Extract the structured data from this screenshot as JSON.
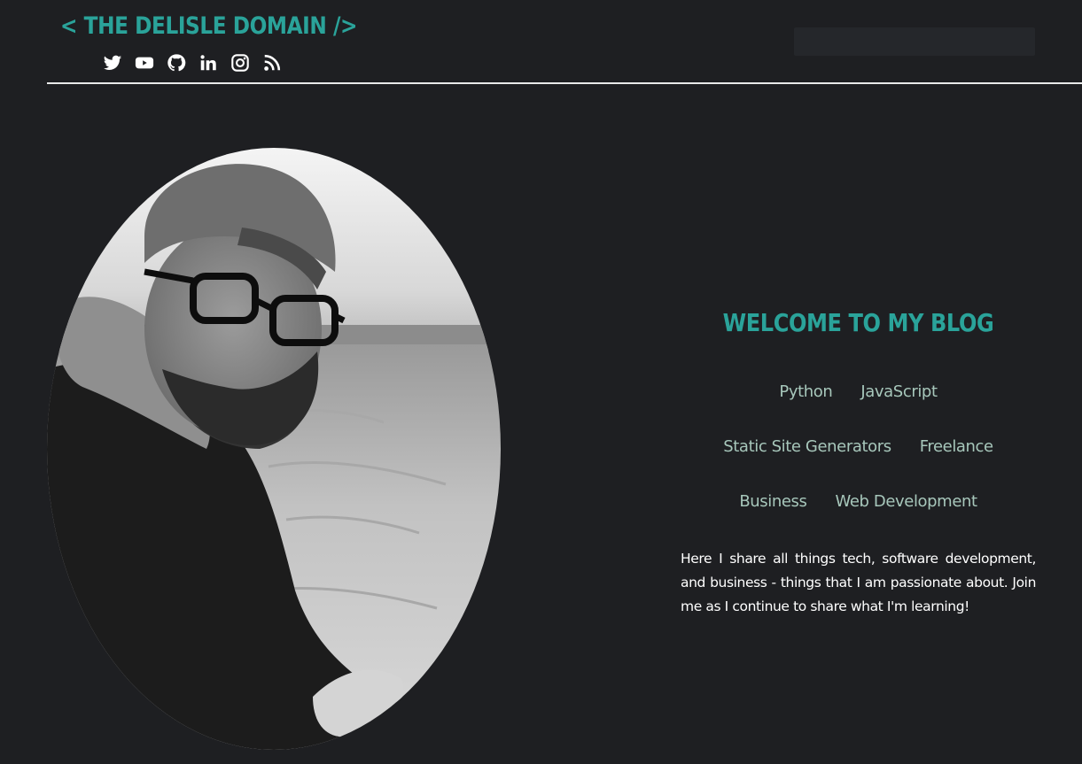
{
  "header": {
    "logo_text": "< THE DELISLE DOMAIN />",
    "social_links": [
      {
        "name": "twitter-icon"
      },
      {
        "name": "youtube-icon"
      },
      {
        "name": "github-icon"
      },
      {
        "name": "linkedin-icon"
      },
      {
        "name": "instagram-icon"
      },
      {
        "name": "rss-icon"
      }
    ],
    "search_placeholder": ""
  },
  "hero": {
    "portrait_alt": "Profile photo on a beach"
  },
  "intro": {
    "title": "WELCOME TO MY BLOG",
    "tag_rows": [
      [
        "Python",
        "JavaScript"
      ],
      [
        "Static Site Generators",
        "Freelance"
      ],
      [
        "Business",
        "Web Development"
      ]
    ],
    "bio": "Here I share all things tech, software development, and business - things that I am passionate about. Join me as I continue to share what I'm learning!"
  },
  "colors": {
    "background": "#1e1f22",
    "accent": "#2aa39a",
    "tag": "#a7c7bb",
    "text": "#ffffff"
  }
}
